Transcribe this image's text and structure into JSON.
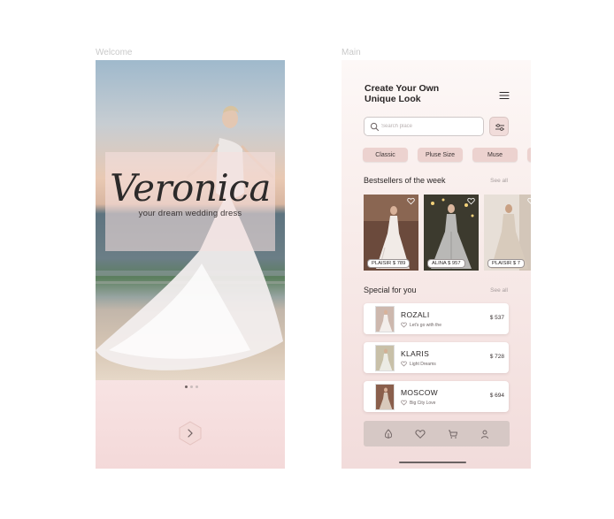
{
  "frames": {
    "welcome_label": "Welcome",
    "main_label": "Main"
  },
  "welcome": {
    "brand": "Veronica",
    "tagline": "your dream wedding dress",
    "pager": {
      "total": 3,
      "active": 1
    },
    "next_icon": "chevron-right-icon"
  },
  "main": {
    "title_line1": "Create Your Own",
    "title_line2": "Unique Look",
    "menu_icon": "hamburger-menu-icon",
    "search": {
      "placeholder": "Search place",
      "value": ""
    },
    "filter_icon": "sliders-icon",
    "categories": [
      "Classic",
      "Pluse Size",
      "Muse",
      ""
    ],
    "bestsellers": {
      "heading": "Bestsellers of the week",
      "see_all": "See all",
      "items": [
        {
          "name": "PLAISIR",
          "price": "$ 789"
        },
        {
          "name": "ALINA",
          "price": "$ 957"
        },
        {
          "name": "PLAISIR",
          "price": "$ 7"
        }
      ]
    },
    "special": {
      "heading": "Special for you",
      "see_all": "See all",
      "items": [
        {
          "name": "ROZALI",
          "subtitle": "Let's go with the",
          "price": "$ 537"
        },
        {
          "name": "KLARIS",
          "subtitle": "Light Dreams",
          "price": "$ 728"
        },
        {
          "name": "MOSCOW",
          "subtitle": "Big City Love",
          "price": "$ 694"
        }
      ]
    },
    "tabbar": [
      "home-icon",
      "heart-icon",
      "cart-icon",
      "profile-icon"
    ]
  },
  "colors": {
    "accent_pink": "#ecd2cf",
    "tabbar": "#d6c8c5",
    "background_gradient_end": "#f2dcdb"
  }
}
